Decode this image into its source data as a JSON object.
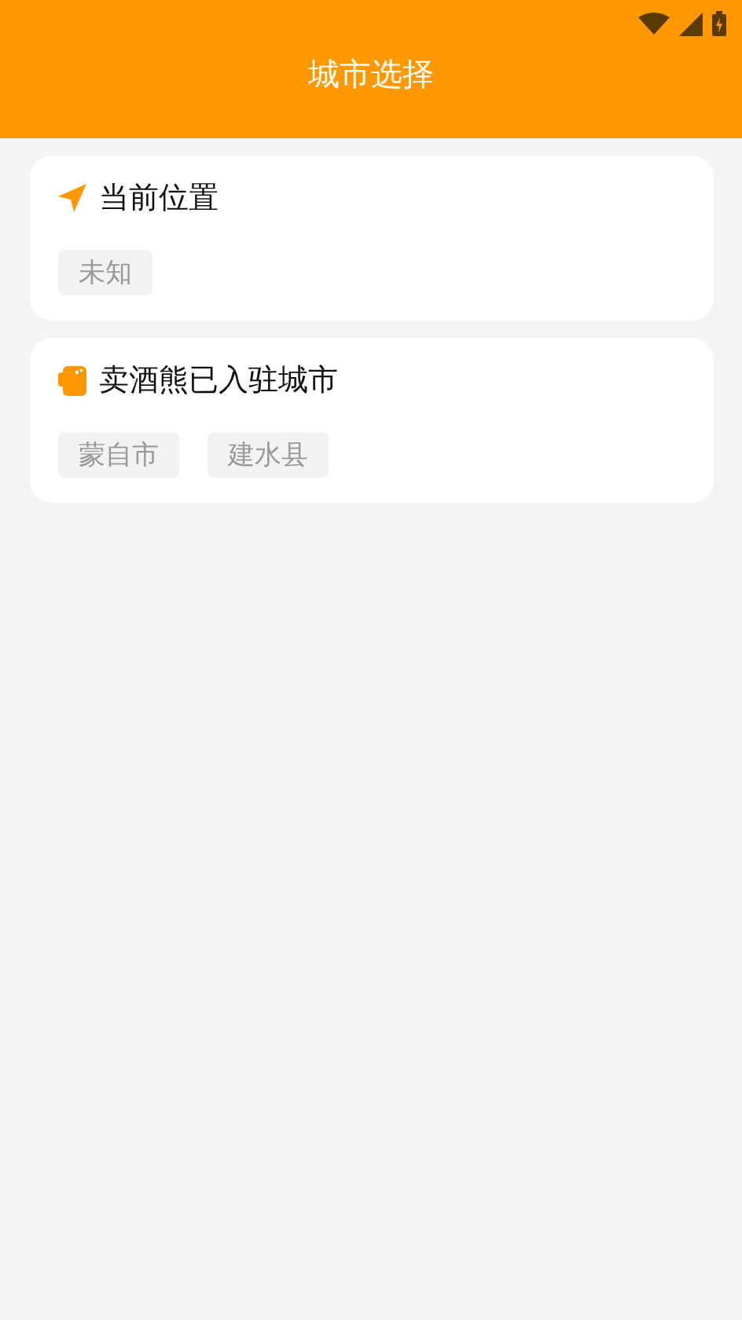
{
  "header": {
    "title": "城市选择"
  },
  "sections": [
    {
      "kind": "location",
      "title": "当前位置",
      "cities": [
        "未知"
      ]
    },
    {
      "kind": "cup",
      "title": "卖酒熊已入驻城市",
      "cities": [
        "蒙自市",
        "建水县"
      ]
    }
  ]
}
